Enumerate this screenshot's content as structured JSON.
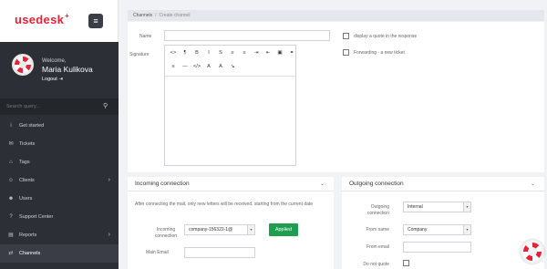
{
  "brand": {
    "logo": "usedesk",
    "logo_plus": "+",
    "accent": "#e2233a"
  },
  "menu_glyph": "≡",
  "user": {
    "welcome": "Welcome,",
    "name": "Maria Kulikova",
    "logout": "Logout"
  },
  "search": {
    "placeholder": "Search query..."
  },
  "nav": [
    {
      "label": "Get started",
      "icon": "info-icon",
      "glyph": "i",
      "chevron": false,
      "active": false
    },
    {
      "label": "Tickets",
      "icon": "inbox-icon",
      "glyph": "✉",
      "chevron": false,
      "active": false
    },
    {
      "label": "Tags",
      "icon": "tag-icon",
      "glyph": "⌂",
      "chevron": false,
      "active": false
    },
    {
      "label": "Clients",
      "icon": "users-icon",
      "glyph": "☺",
      "chevron": true,
      "active": false
    },
    {
      "label": "Users",
      "icon": "user-icon",
      "glyph": "☻",
      "chevron": false,
      "active": false
    },
    {
      "label": "Support Center",
      "icon": "question-icon",
      "glyph": "?",
      "chevron": false,
      "active": false
    },
    {
      "label": "Reports",
      "icon": "chart-icon",
      "glyph": "▤",
      "chevron": true,
      "active": false
    },
    {
      "label": "Channels",
      "icon": "channels-icon",
      "glyph": "⇄",
      "chevron": false,
      "active": true
    }
  ],
  "breadcrumb": {
    "root": "Channels",
    "separator": "/",
    "current": "Create channel"
  },
  "form": {
    "name_label": "Name",
    "name_value": "",
    "signature_label": "Signature",
    "option_quote": "display a quote in the response",
    "option_forward": "Forwarding - a new ticket"
  },
  "toolbar": {
    "row1": [
      "<>",
      "¶",
      "B",
      "I",
      "S",
      "≡",
      "≡",
      "⇥",
      "⇤",
      "▣",
      "⚭"
    ],
    "row2": [
      "≡",
      "—",
      "</>",
      "A",
      "A",
      "↘"
    ]
  },
  "incoming": {
    "title": "Incoming connection",
    "note": "After connecting the mail, only new letters will be received, starting from the current date",
    "conn_label": "Incoming connection",
    "conn_value": "company-156322-1@",
    "applied_button": "Applied",
    "main_email_label": "Main Email"
  },
  "outgoing": {
    "title": "Outgoing connection",
    "conn_label": "Outgoing connection",
    "conn_value": "Internal",
    "from_name_label": "From name",
    "from_name_value": "Company",
    "from_email_label": "From email",
    "do_not_quote_label": "Do not quote"
  }
}
